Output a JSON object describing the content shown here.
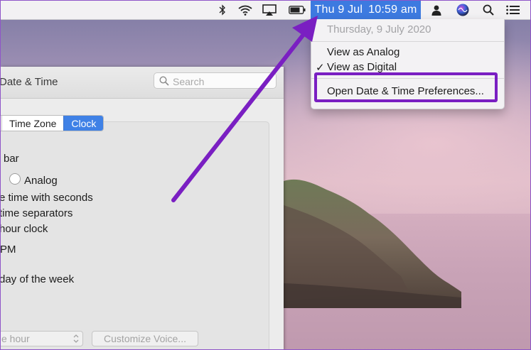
{
  "menubar": {
    "icons": [
      "bluetooth-icon",
      "wifi-icon",
      "airplay-icon",
      "battery-icon",
      "user-icon",
      "siri-icon",
      "search-icon",
      "notification-center-icon"
    ],
    "clock": {
      "day": "Thu 9 Jul",
      "time": "10:59 am"
    }
  },
  "clock_menu": {
    "date_header": "Thursday, 9 July 2020",
    "items": [
      "View as Analog",
      "View as Digital",
      "Open Date & Time Preferences..."
    ],
    "checked_item": "View as Digital"
  },
  "prefs_window": {
    "title": "Date & Time",
    "search_placeholder": "Search",
    "tabs": [
      "Time Zone",
      "Clock"
    ],
    "active_tab": "Clock",
    "options": [
      "bar",
      "Analog",
      "e time with seconds",
      "time separators",
      "hour clock",
      "PM",
      "day of the week"
    ],
    "announce_popup": "e hour",
    "customize_voice_button": "Customize Voice..."
  },
  "colors": {
    "highlight": "#7a1fc2",
    "accent": "#3d7ae0"
  }
}
